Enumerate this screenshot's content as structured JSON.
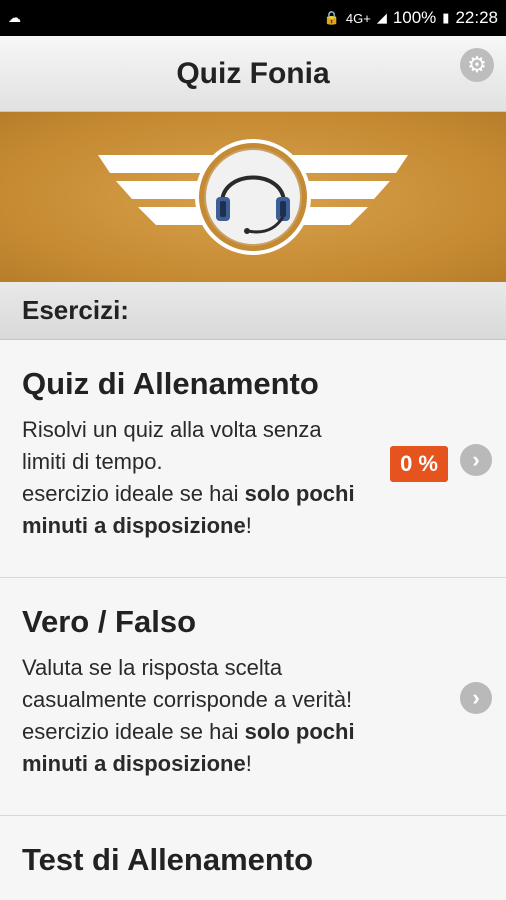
{
  "status_bar": {
    "network": "4G+",
    "battery": "100%",
    "time": "22:28"
  },
  "header": {
    "title": "Quiz Fonia"
  },
  "section": {
    "label": "Esercizi:"
  },
  "items": [
    {
      "title": "Quiz di Allenamento",
      "desc_line1": "Risolvi un quiz alla volta senza",
      "desc_line2": "limiti di tempo.",
      "desc_line3_plain": "esercizio ideale se hai ",
      "desc_line3_bold": "solo pochi",
      "desc_line4_bold": "minuti a disposizione",
      "desc_line4_plain": "!",
      "badge": "0 %"
    },
    {
      "title": "Vero / Falso",
      "desc_line1": "Valuta se la risposta scelta",
      "desc_line2": "casualmente corrisponde a verità!",
      "desc_line3_plain": "esercizio ideale se hai ",
      "desc_line3_bold": "solo pochi",
      "desc_line4_bold": "minuti a disposizione",
      "desc_line4_plain": "!"
    },
    {
      "title": "Test di Allenamento"
    }
  ],
  "colors": {
    "banner": "#c8903a",
    "badge": "#e5541e"
  }
}
